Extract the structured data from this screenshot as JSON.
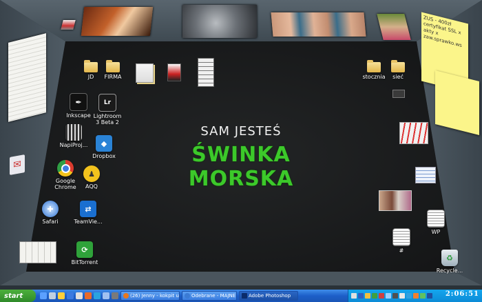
{
  "wallpaper": {
    "line1": "SAM JESTEŚ",
    "line2": "ŚWINKA MORSKA",
    "line2_color": "#3cc92a"
  },
  "desktop_icons": [
    {
      "id": "jd",
      "label": "JD",
      "icon": "folder-icon"
    },
    {
      "id": "firma",
      "label": "FIRMA",
      "icon": "folder-icon"
    },
    {
      "id": "inkscape",
      "label": "Inkscape",
      "icon": "inkscape-icon"
    },
    {
      "id": "lightroom",
      "label": "Lightroom\n3 Beta 2",
      "icon": "lightroom-icon"
    },
    {
      "id": "napiproj",
      "label": "NapiProj...",
      "icon": "film-icon"
    },
    {
      "id": "dropbox",
      "label": "Dropbox",
      "icon": "dropbox-icon"
    },
    {
      "id": "chrome",
      "label": "Google\nChrome",
      "icon": "chrome-icon"
    },
    {
      "id": "aqq",
      "label": "AQQ",
      "icon": "aqq-icon"
    },
    {
      "id": "safari",
      "label": "Safari",
      "icon": "safari-icon"
    },
    {
      "id": "teamviewer",
      "label": "TeamVie...",
      "icon": "teamviewer-icon"
    },
    {
      "id": "bittorrent",
      "label": "BitTorrent",
      "icon": "bittorrent-icon"
    },
    {
      "id": "stocznia",
      "label": "stocznia",
      "icon": "folder-icon"
    },
    {
      "id": "siec",
      "label": "sieć",
      "icon": "folder-icon"
    },
    {
      "id": "wp",
      "label": "WP",
      "icon": "document-icon"
    },
    {
      "id": "hash",
      "label": "#",
      "icon": "document-icon"
    },
    {
      "id": "recycle",
      "label": "Recycle...",
      "icon": "recycle-bin-icon"
    }
  ],
  "sticky_note": {
    "lines": [
      "ZUS - 400zł",
      "certyfikat SSL x",
      "akty x",
      "zaw.sprawko.ws"
    ]
  },
  "taskbar": {
    "start_label": "start",
    "windows": [
      {
        "label": "(26) Jenny - kokpit uż...",
        "icon_color": "#e8771e"
      },
      {
        "label": "Odebrane - MAJNE - ...",
        "icon_color": "#3b7bd4"
      },
      {
        "label": "Adobe Photoshop",
        "icon_color": "#0b2c6b"
      }
    ],
    "clock": "2:06:51"
  }
}
